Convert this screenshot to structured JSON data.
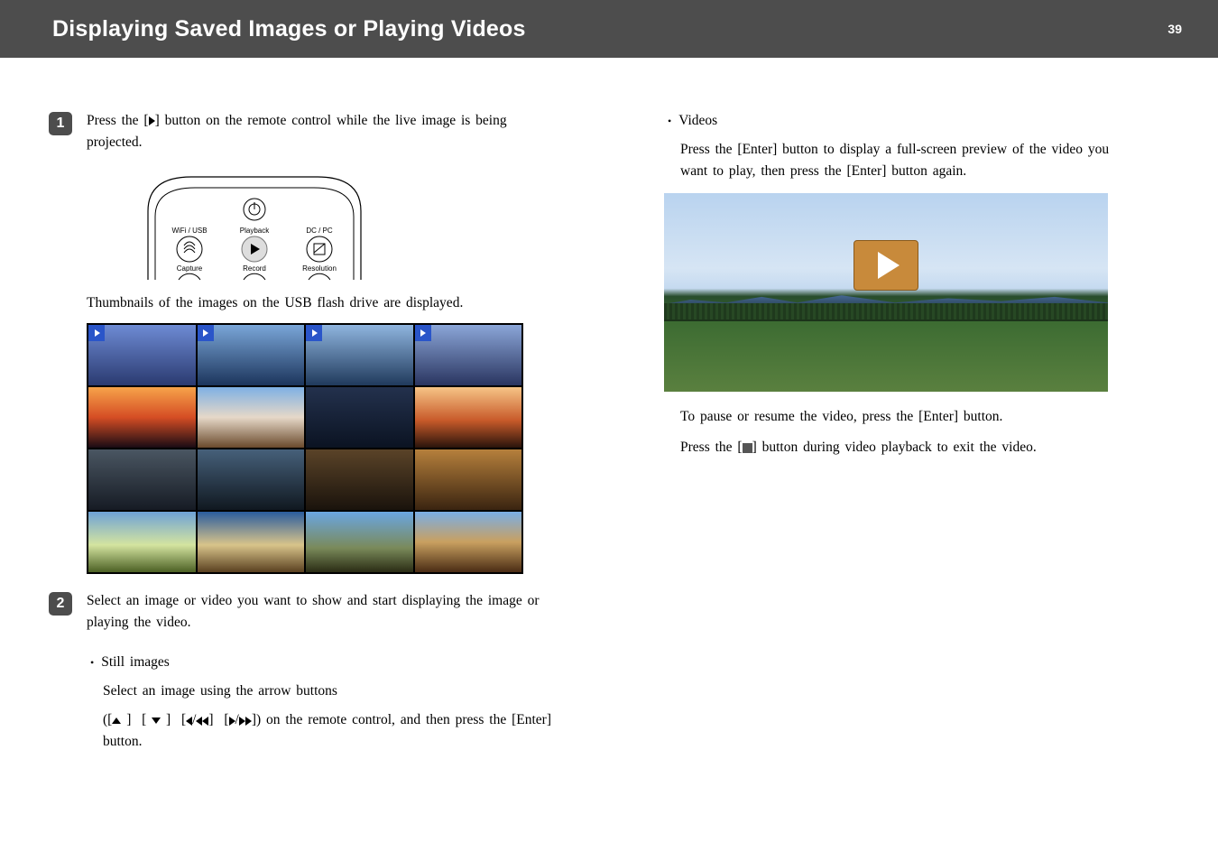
{
  "header": {
    "title": "Displaying Saved Images or Playing Videos",
    "page_number": "39"
  },
  "left": {
    "step1_a": "Press the [",
    "step1_b": "] button on the remote control while the live image is being projected.",
    "remote_labels": {
      "wifi_usb": "WiFi / USB",
      "playback": "Playback",
      "dc_pc": "DC / PC",
      "capture": "Capture",
      "record": "Record",
      "resolution": "Resolution"
    },
    "thumbs_caption": "Thumbnails of the images on the USB flash drive are displayed.",
    "step2": "Select an image or video you want to show and start displaying the image or playing the video.",
    "still_heading": "Still images",
    "still_a": "Select an image using the arrow buttons",
    "still_b_open": "([",
    "still_b_mid": "]) on the remote control, and then press the [Enter] button."
  },
  "right": {
    "videos_heading": "Videos",
    "videos_p1": "Press the [Enter] button to display a full-screen preview of the video you want to play, then press the [Enter] button again.",
    "videos_p2": "To pause or resume the video, press the [Enter] button.",
    "videos_p3a": "Press the [",
    "videos_p3b": "] button during video playback to exit the video."
  }
}
